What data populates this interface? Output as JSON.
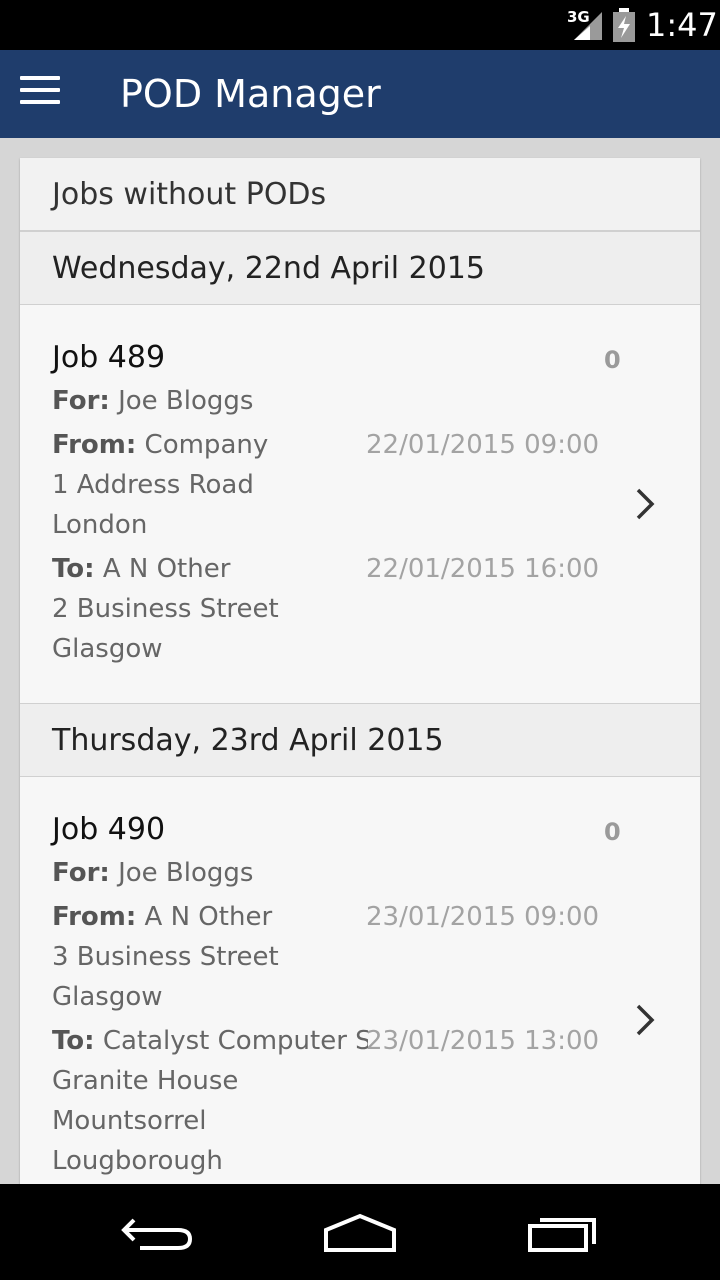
{
  "status_bar": {
    "network": "3G",
    "time": "1:47"
  },
  "app_bar": {
    "title": "POD Manager",
    "menu_icon": "hamburger-menu-icon"
  },
  "card": {
    "header": "Jobs without PODs"
  },
  "groups": [
    {
      "date": "Wednesday, 22nd April 2015",
      "job": {
        "title": "Job 489",
        "count": "0",
        "for_label": "For:",
        "for_value": "Joe Bloggs",
        "from_label": "From:",
        "from_value": "Company",
        "from_address": [
          "1 Address Road",
          "London"
        ],
        "from_time": "22/01/2015 09:00",
        "to_label": "To:",
        "to_value": "A N Other",
        "to_address": [
          "2 Business Street",
          "Glasgow"
        ],
        "to_time": "22/01/2015 16:00"
      }
    },
    {
      "date": "Thursday, 23rd April 2015",
      "job": {
        "title": "Job 490",
        "count": "0",
        "for_label": "For:",
        "for_value": "Joe Bloggs",
        "from_label": "From:",
        "from_value": "A N Other",
        "from_address": [
          "3 Business Street",
          "Glasgow"
        ],
        "from_time": "23/01/2015 09:00",
        "to_label": "To:",
        "to_value": "Catalyst Computer S..",
        "to_address": [
          "Granite House",
          "Mountsorrel",
          "Lougborough"
        ],
        "to_time": "23/01/2015 13:00"
      }
    }
  ],
  "colors": {
    "app_bar": "#1f3d6c",
    "background": "#d6d6d6",
    "card": "#f7f7f7"
  }
}
